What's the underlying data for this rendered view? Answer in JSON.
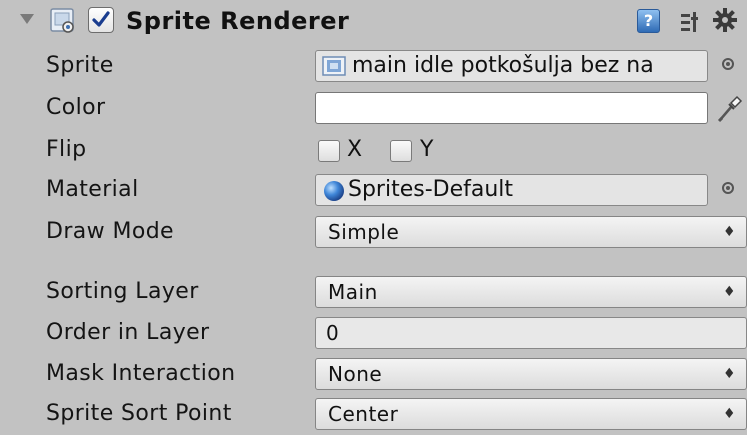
{
  "component": {
    "title": "Sprite Renderer",
    "enabled": true,
    "help_glyph": "?"
  },
  "fields": {
    "sprite": {
      "label": "Sprite",
      "value": "main idle potkošulja bez na"
    },
    "color": {
      "label": "Color",
      "value": "#ffffff"
    },
    "flip": {
      "label": "Flip",
      "x_label": "X",
      "y_label": "Y",
      "x_checked": false,
      "y_checked": false
    },
    "material": {
      "label": "Material",
      "value": "Sprites-Default"
    },
    "draw_mode": {
      "label": "Draw Mode",
      "value": "Simple"
    },
    "sorting_layer": {
      "label": "Sorting Layer",
      "value": "Main"
    },
    "order_in_layer": {
      "label": "Order in Layer",
      "value": "0"
    },
    "mask_interaction": {
      "label": "Mask Interaction",
      "value": "None"
    },
    "sprite_sort_point": {
      "label": "Sprite Sort Point",
      "value": "Center"
    }
  },
  "icons": {
    "dropdown_arrows": "⇕",
    "arrow_glyph": "♦"
  }
}
